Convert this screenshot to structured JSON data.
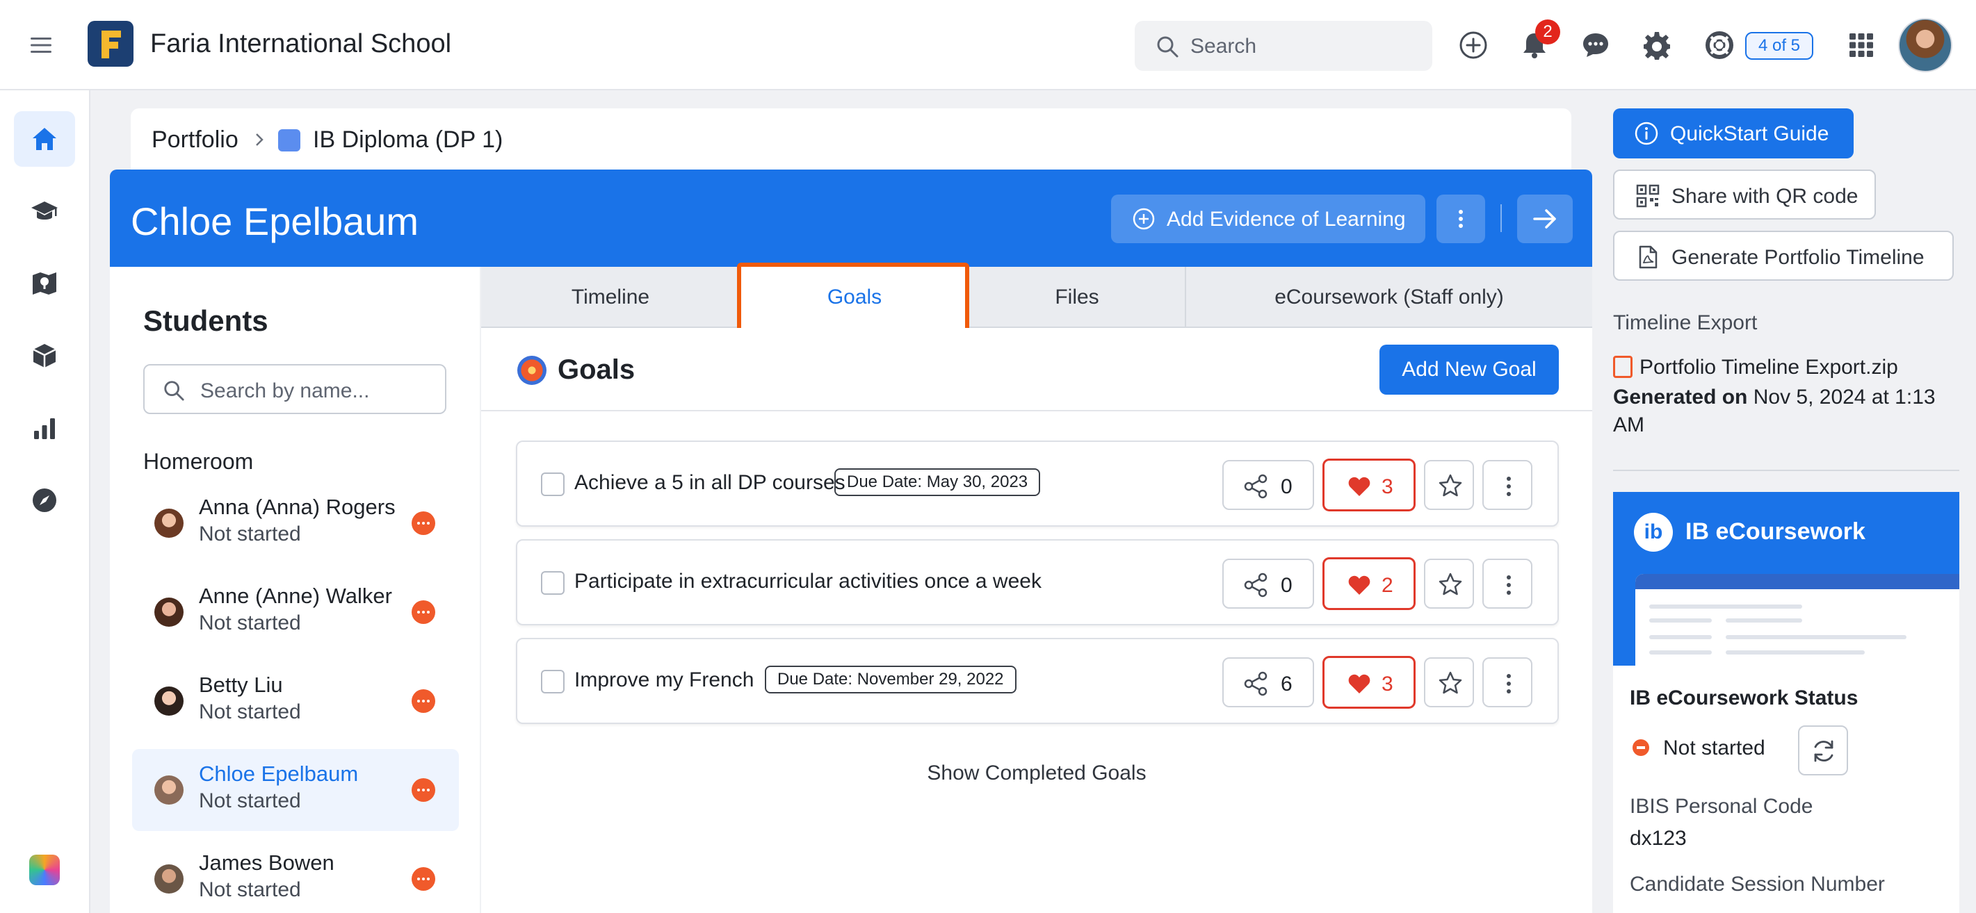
{
  "topbar": {
    "school_name": "Faria International School",
    "search_label": "Search",
    "notifications_count": "2",
    "progress_label": "4 of 5"
  },
  "rail": {
    "items": [
      "home-icon",
      "graduation-cap-icon",
      "map-icon",
      "cube-icon",
      "bar-chart-icon",
      "compass-icon"
    ],
    "active_index": 0
  },
  "breadcrumb": {
    "root": "Portfolio",
    "current": "IB Diploma (DP 1)"
  },
  "student_header": {
    "name": "Chloe Epelbaum",
    "add_evidence_label": "Add Evidence of Learning"
  },
  "students": {
    "title": "Students",
    "search_placeholder": "Search by name...",
    "group_label": "Homeroom",
    "items": [
      {
        "name": "Anna (Anna) Rogers",
        "status": "Not started",
        "selected": false
      },
      {
        "name": "Anne (Anne) Walker",
        "status": "Not started",
        "selected": false
      },
      {
        "name": "Betty Liu",
        "status": "Not started",
        "selected": false
      },
      {
        "name": "Chloe Epelbaum",
        "status": "Not started",
        "selected": true
      },
      {
        "name": "James Bowen",
        "status": "Not started",
        "selected": false
      }
    ]
  },
  "tabs": {
    "items": [
      "Timeline",
      "Goals",
      "Files",
      "eCoursework (Staff only)"
    ],
    "active": "Goals"
  },
  "goals": {
    "title": "Goals",
    "add_button": "Add New Goal",
    "items": [
      {
        "text": "Achieve a 5 in all DP courses",
        "due": "Due Date: May 30, 2023",
        "shares": "0",
        "likes": "3"
      },
      {
        "text": "Participate in extracurricular activities once a week",
        "due": "",
        "shares": "0",
        "likes": "2"
      },
      {
        "text": "Improve my French",
        "due": "Due Date: November 29, 2022",
        "shares": "6",
        "likes": "3"
      }
    ],
    "show_completed": "Show Completed Goals"
  },
  "right_panel": {
    "quickstart_label": "QuickStart Guide",
    "share_qr_label": "Share with QR code",
    "generate_timeline_label": "Generate Portfolio Timeline",
    "export_heading": "Timeline Export",
    "export_file": "Portfolio Timeline Export.zip",
    "generated_label": "Generated on",
    "generated_value": "Nov 5, 2024 at 1:13 AM",
    "ecoursework": {
      "logo_text": "ib",
      "title": "IB eCoursework",
      "status_title": "IB eCoursework Status",
      "status": "Not started",
      "ibis_label": "IBIS Personal Code",
      "ibis_value": "dx123",
      "session_label": "Candidate Session Number"
    }
  },
  "colors": {
    "brand_blue": "#1a73e8",
    "status_orange": "#f05a2b",
    "like_red": "#e0392b",
    "highlight_orange": "#f05a0a"
  }
}
